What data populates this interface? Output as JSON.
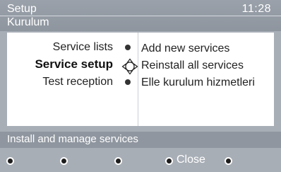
{
  "header": {
    "title": "Setup",
    "subtitle": "Kurulum",
    "time": "11:28"
  },
  "menu": {
    "items": [
      {
        "label": "Service lists",
        "selected": false
      },
      {
        "label": "Service setup",
        "selected": true
      },
      {
        "label": "Test reception",
        "selected": false
      }
    ]
  },
  "submenu": {
    "items": [
      {
        "label": "Add new services"
      },
      {
        "label": "Reinstall all services"
      },
      {
        "label": "Elle kurulum hizmetleri"
      }
    ]
  },
  "help": {
    "text": "Install and manage services"
  },
  "footer": {
    "close_label": "Close"
  },
  "icons": {
    "nav": "navigation-pad-icon",
    "radio": "radio-dot-icon"
  }
}
